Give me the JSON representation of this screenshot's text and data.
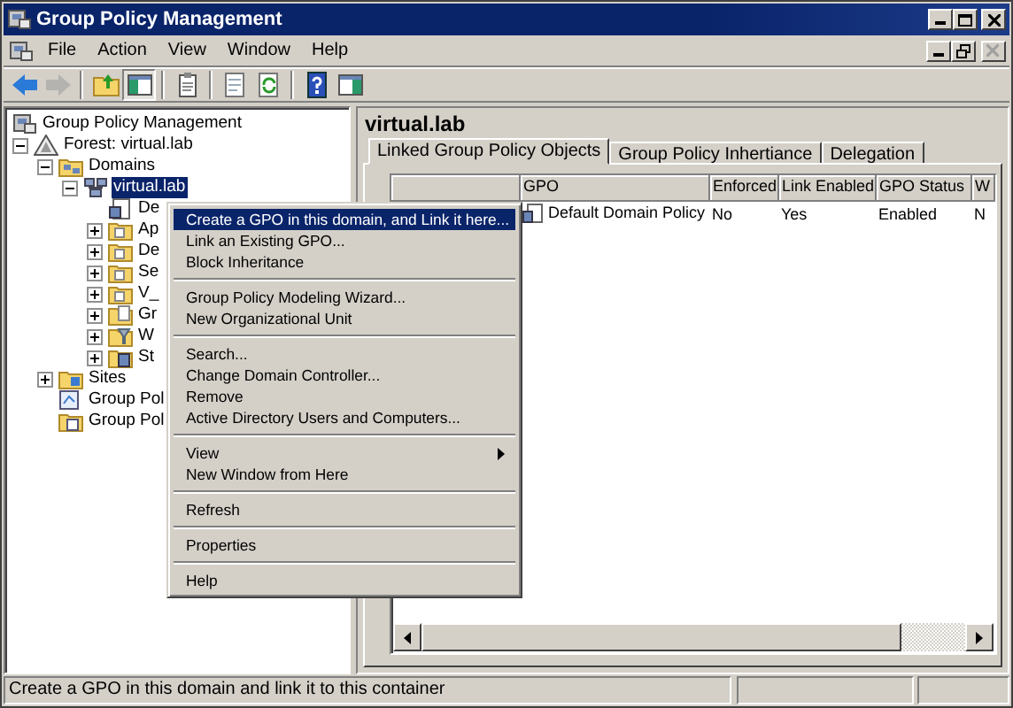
{
  "window": {
    "title": "Group Policy Management"
  },
  "menu_bar": [
    "File",
    "Action",
    "View",
    "Window",
    "Help"
  ],
  "toolbar": [
    {
      "kind": "back",
      "disabled": false,
      "pressed": false
    },
    {
      "kind": "forward",
      "disabled": true,
      "pressed": false
    },
    {
      "kind": "separator"
    },
    {
      "kind": "up",
      "disabled": false,
      "pressed": false
    },
    {
      "kind": "tree",
      "disabled": false,
      "pressed": true
    },
    {
      "kind": "separator"
    },
    {
      "kind": "properties",
      "disabled": false,
      "pressed": false
    },
    {
      "kind": "separator"
    },
    {
      "kind": "export",
      "disabled": false,
      "pressed": false
    },
    {
      "kind": "refresh",
      "disabled": false,
      "pressed": false
    },
    {
      "kind": "separator"
    },
    {
      "kind": "help",
      "disabled": false,
      "pressed": false
    },
    {
      "kind": "action-pane",
      "disabled": false,
      "pressed": false
    }
  ],
  "tree": {
    "label": "Group Policy Management",
    "kind": "console",
    "selected": false,
    "children": [
      {
        "label": "Forest: virtual.lab",
        "kind": "forest",
        "expanded": true,
        "selected": false,
        "children": [
          {
            "label": "Domains",
            "kind": "domains",
            "expanded": true,
            "selected": false,
            "children": [
              {
                "label": "virtual.lab",
                "kind": "domain",
                "expanded": true,
                "selected": true,
                "children": [
                  {
                    "label": "De",
                    "kind": "gpo-link",
                    "selected": false
                  },
                  {
                    "label": "Ap",
                    "kind": "ou",
                    "expanded": false,
                    "selected": false
                  },
                  {
                    "label": "De",
                    "kind": "ou",
                    "expanded": false,
                    "selected": false
                  },
                  {
                    "label": "Se",
                    "kind": "ou",
                    "expanded": false,
                    "selected": false
                  },
                  {
                    "label": "V_",
                    "kind": "ou",
                    "expanded": false,
                    "selected": false
                  },
                  {
                    "label": "Gr",
                    "kind": "gpo-folder",
                    "expanded": false,
                    "selected": false
                  },
                  {
                    "label": "W",
                    "kind": "wmi",
                    "expanded": false,
                    "selected": false
                  },
                  {
                    "label": "St",
                    "kind": "starter",
                    "expanded": false,
                    "selected": false
                  }
                ]
              }
            ]
          },
          {
            "label": "Sites",
            "kind": "sites",
            "expanded": false,
            "selected": false
          },
          {
            "label": "Group Pol",
            "kind": "modeling",
            "selected": false
          },
          {
            "label": "Group Pol",
            "kind": "results",
            "selected": false
          }
        ]
      }
    ]
  },
  "details": {
    "title": "virtual.lab",
    "tabs": [
      {
        "label": "Linked Group Policy Objects",
        "selected": true
      },
      {
        "label": "Group Policy Inhertiance",
        "selected": false
      },
      {
        "label": "Delegation",
        "selected": false
      }
    ],
    "table": {
      "columns": [
        "GPO",
        "Enforced",
        "Link Enabled",
        "GPO Status",
        "W"
      ],
      "rows": [
        {
          "cells": [
            "Default Domain Policy",
            "No",
            "Yes",
            "Enabled",
            "N"
          ]
        }
      ]
    }
  },
  "context_menu": {
    "items": [
      {
        "kind": "item",
        "label": "Create a GPO in this domain, and Link it here...",
        "selected": true,
        "submenu": false
      },
      {
        "kind": "item",
        "label": "Link an Existing GPO...",
        "selected": false,
        "submenu": false
      },
      {
        "kind": "item",
        "label": "Block Inheritance",
        "selected": false,
        "submenu": false
      },
      {
        "kind": "separator"
      },
      {
        "kind": "item",
        "label": "Group Policy Modeling Wizard...",
        "selected": false,
        "submenu": false
      },
      {
        "kind": "item",
        "label": "New Organizational Unit",
        "selected": false,
        "submenu": false
      },
      {
        "kind": "separator"
      },
      {
        "kind": "item",
        "label": "Search...",
        "selected": false,
        "submenu": false
      },
      {
        "kind": "item",
        "label": "Change Domain Controller...",
        "selected": false,
        "submenu": false
      },
      {
        "kind": "item",
        "label": "Remove",
        "selected": false,
        "submenu": false
      },
      {
        "kind": "item",
        "label": "Active Directory Users and Computers...",
        "selected": false,
        "submenu": false
      },
      {
        "kind": "separator"
      },
      {
        "kind": "item",
        "label": "View",
        "selected": false,
        "submenu": true
      },
      {
        "kind": "item",
        "label": "New Window from Here",
        "selected": false,
        "submenu": false
      },
      {
        "kind": "separator"
      },
      {
        "kind": "item",
        "label": "Refresh",
        "selected": false,
        "submenu": false
      },
      {
        "kind": "separator"
      },
      {
        "kind": "item",
        "label": "Properties",
        "selected": false,
        "submenu": false
      },
      {
        "kind": "separator"
      },
      {
        "kind": "item",
        "label": "Help",
        "selected": false,
        "submenu": false
      }
    ]
  },
  "status_bar": {
    "text": "Create a GPO in this domain and link it to this container"
  }
}
